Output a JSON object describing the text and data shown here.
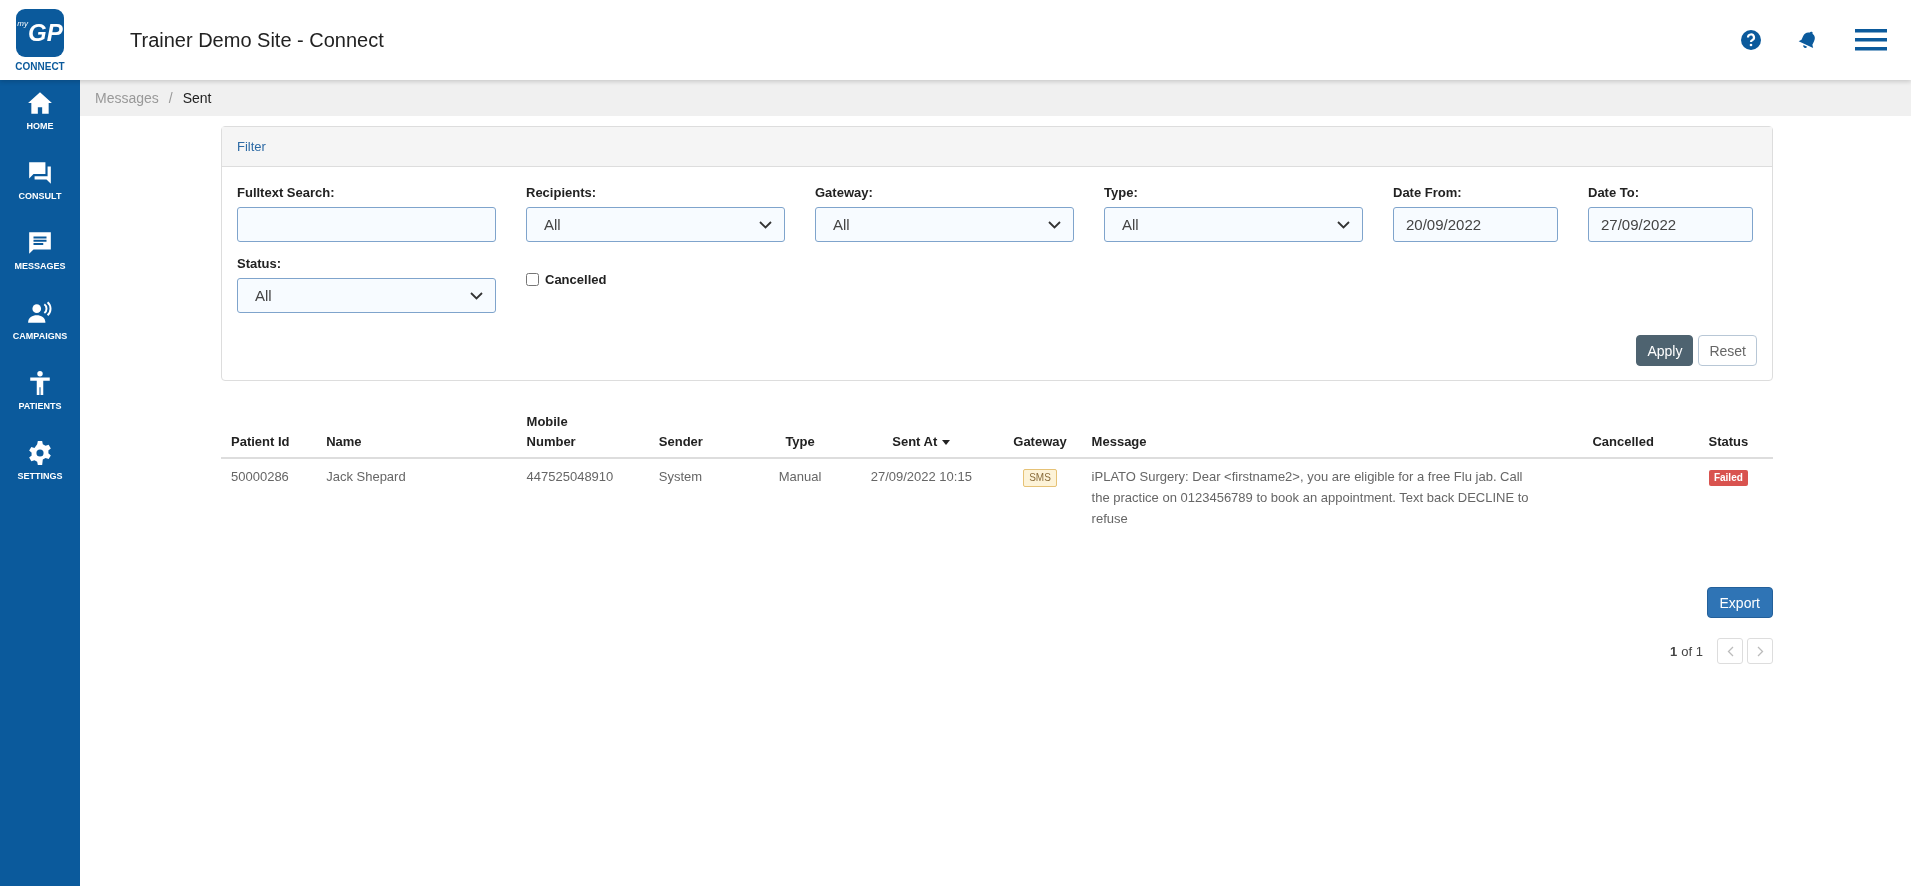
{
  "logo": {
    "mark": "GP",
    "superscript": "my",
    "caption": "CONNECT"
  },
  "header": {
    "title": "Trainer Demo Site - Connect"
  },
  "sidebar": {
    "items": [
      {
        "label": "HOME",
        "kind": "home"
      },
      {
        "label": "CONSULT",
        "kind": "consult"
      },
      {
        "label": "MESSAGES",
        "kind": "messages"
      },
      {
        "label": "CAMPAIGNS",
        "kind": "campaigns"
      },
      {
        "label": "PATIENTS",
        "kind": "patients"
      },
      {
        "label": "SETTINGS",
        "kind": "settings"
      }
    ]
  },
  "breadcrumb": {
    "items": [
      "Messages",
      "Sent"
    ],
    "separator": "/"
  },
  "filter": {
    "title": "Filter",
    "fields": [
      {
        "label": "Fulltext Search:",
        "kind": "text"
      },
      {
        "label": "Recipients:",
        "kind": "select",
        "value": "All"
      },
      {
        "label": "Gateway:",
        "kind": "select",
        "value": "All"
      },
      {
        "label": "Type:",
        "kind": "select",
        "value": "All"
      },
      {
        "label": "Date From:",
        "kind": "date",
        "value": "20/09/2022"
      },
      {
        "label": "Date To:",
        "kind": "date",
        "value": "27/09/2022"
      },
      {
        "label": "Status:",
        "kind": "select",
        "value": "All"
      },
      {
        "label": "Cancelled",
        "kind": "checkbox",
        "checked": false
      }
    ],
    "buttons": [
      "Apply",
      "Reset"
    ]
  },
  "table": {
    "columns": [
      {
        "label": "Patient Id",
        "sorted": false
      },
      {
        "label": "Name",
        "sorted": false
      },
      {
        "label": "Mobile Number",
        "sorted": false
      },
      {
        "label": "Sender",
        "sorted": false
      },
      {
        "label": "Type",
        "sorted": false
      },
      {
        "label": "Sent At",
        "sorted": true
      },
      {
        "label": "Gateway",
        "sorted": false
      },
      {
        "label": "Message",
        "sorted": false
      },
      {
        "label": "Cancelled",
        "sorted": false
      },
      {
        "label": "Status",
        "sorted": false
      }
    ],
    "rows": [
      {
        "patient_id": "50000286",
        "name": "Jack Shepard",
        "mobile_number": "447525048910",
        "sender": "System",
        "type": "Manual",
        "sent_at": "27/09/2022 10:15",
        "gateway": "SMS",
        "message": "iPLATO Surgery: Dear <firstname2>, you are eligible for a free Flu jab. Call the practice on 0123456789 to book an appointment. Text back DECLINE to refuse",
        "status": "Failed"
      }
    ]
  },
  "export_button": "Export",
  "pagination": {
    "current": "1",
    "of_total": "of 1"
  }
}
